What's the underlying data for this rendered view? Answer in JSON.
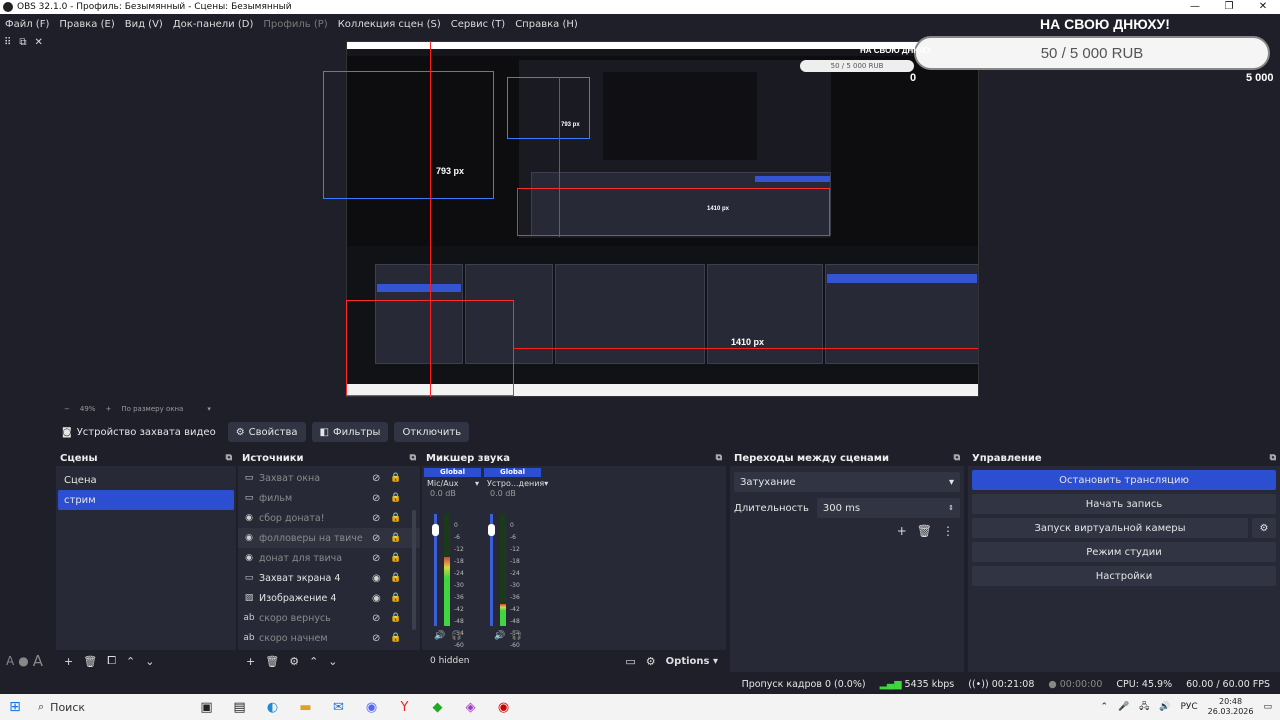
{
  "window": {
    "title": "OBS 32.1.0 - Профиль: Безымянный - Сцены: Безымянный",
    "controls": [
      "—",
      "❐",
      "✕"
    ]
  },
  "menu": [
    "Файл (F)",
    "Правка (E)",
    "Вид (V)",
    "Док-панели (D)",
    "Профиль (P)",
    "Коллекция сцен (S)",
    "Сервис (T)",
    "Справка (H)"
  ],
  "menu_disabled_index": 4,
  "dock_buttons": [
    "⠿",
    "⧉",
    "✕"
  ],
  "preview": {
    "labels": [
      "793 px",
      "793 px",
      "1410 px",
      "1410 px"
    ],
    "overlay_title": "НА СВОЮ ДНЮХУ!",
    "overlay_bar": "50 / 5 000 RUB",
    "overlay_min": "0",
    "overlay_max": "5 000",
    "mini_overlay_title": "НА СВОЮ ДНЮХУ",
    "mini_overlay_bar": "50 / 5 000 RUB"
  },
  "zoom": {
    "minus": "−",
    "value": "49%",
    "plus": "+",
    "fit": "По размеру окна"
  },
  "source_toolbar": {
    "source_name": "Устройство захвата видео",
    "properties": "Свойства",
    "filters": "Фильтры",
    "disable": "Отключить"
  },
  "scenes": {
    "title": "Сцены",
    "items": [
      "Сцена",
      "стрим"
    ],
    "selected": 1
  },
  "sources": {
    "title": "Источники",
    "items": [
      {
        "label": "Захват окна",
        "icon": "window-icon",
        "visible": false
      },
      {
        "label": "фильм",
        "icon": "window-icon",
        "visible": false
      },
      {
        "label": "сбор доната!",
        "icon": "browser-icon",
        "visible": false
      },
      {
        "label": "фолловеры на твиче",
        "icon": "browser-icon",
        "visible": false
      },
      {
        "label": "донат для твича",
        "icon": "browser-icon",
        "visible": false
      },
      {
        "label": "Захват экрана 4",
        "icon": "monitor-icon",
        "visible": true
      },
      {
        "label": "Изображение 4",
        "icon": "image-icon",
        "visible": true
      },
      {
        "label": "скоро вернусь",
        "icon": "text-icon",
        "visible": false
      },
      {
        "label": "скоро начнем",
        "icon": "text-icon",
        "visible": false
      }
    ]
  },
  "mixer": {
    "title": "Микшер звука",
    "channels": [
      {
        "global": "Global",
        "name": "Mic/Aux",
        "db": "0.0 dB",
        "level": 0.62
      },
      {
        "global": "Global",
        "name": "Устро...дения",
        "db": "0.0 dB",
        "level": 0.2
      }
    ],
    "scale": [
      "0",
      "-6",
      "-12",
      "-18",
      "-24",
      "-30",
      "-36",
      "-42",
      "-48",
      "-54",
      "-60"
    ],
    "hidden": "0 hidden",
    "options": "Options"
  },
  "transitions": {
    "title": "Переходы между сценами",
    "selected": "Затухание",
    "duration_label": "Длительность",
    "duration_value": "300 ms"
  },
  "controls": {
    "title": "Управление",
    "buttons": [
      "Остановить трансляцию",
      "Начать запись",
      "Запуск виртуальной камеры",
      "Режим студии",
      "Настройки"
    ]
  },
  "status": {
    "dropped": "Пропуск кадров 0 (0.0%)",
    "bitrate": "5435 kbps",
    "stream_time": "00:21:08",
    "rec_time": "00:00:00",
    "cpu": "CPU: 45.9%",
    "fps": "60.00 / 60.00 FPS"
  },
  "taskbar": {
    "search": "Поиск",
    "lang": "РУС",
    "time": "20:48",
    "date": "26.03.2026"
  },
  "colors": {
    "accent": "#2c4fd1",
    "bg": "#1e1f29",
    "panel": "#272a36",
    "red": "#ff1e1e"
  }
}
